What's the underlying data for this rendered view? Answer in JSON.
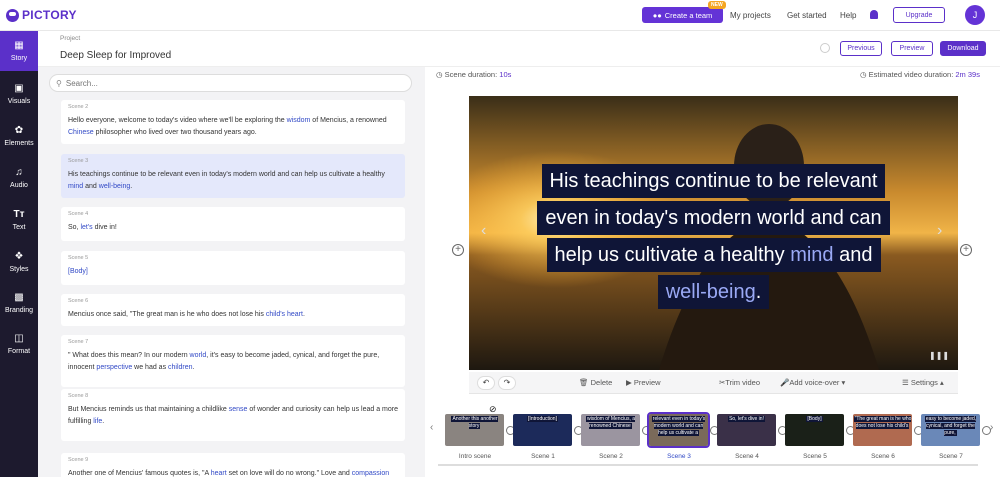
{
  "brand": {
    "name": "PICTORY"
  },
  "topnav": {
    "create_team": "Create a team",
    "new_badge": "NEW",
    "my_projects": "My projects",
    "get_started": "Get started",
    "help": "Help",
    "upgrade": "Upgrade",
    "avatar": "J"
  },
  "sidebar": {
    "items": [
      {
        "label": "Story",
        "icon": "story-icon"
      },
      {
        "label": "Visuals",
        "icon": "visuals-icon"
      },
      {
        "label": "Elements",
        "icon": "elements-icon"
      },
      {
        "label": "Audio",
        "icon": "audio-icon"
      },
      {
        "label": "Text",
        "icon": "text-icon"
      },
      {
        "label": "Styles",
        "icon": "styles-icon"
      },
      {
        "label": "Branding",
        "icon": "branding-icon"
      },
      {
        "label": "Format",
        "icon": "format-icon"
      }
    ]
  },
  "project": {
    "label": "Project",
    "title": "Deep Sleep for Improved"
  },
  "header_buttons": {
    "previous": "Previous",
    "preview": "Preview",
    "download": "Download"
  },
  "search": {
    "placeholder": "Search..."
  },
  "scenes": [
    {
      "label": "Scene 2",
      "html": "Hello everyone, welcome to today's video where we'll be exploring the <b>wisdom</b> of Mencius, a renowned <b>Chinese</b> philosopher who lived over two thousand years ago."
    },
    {
      "label": "Scene 3",
      "html": "His teachings continue to be relevant even in today's modern world and can help us cultivate a healthy <b>mind</b> and <b>well-being</b>."
    },
    {
      "label": "Scene 4",
      "html": "So, <b>let's</b> dive in!"
    },
    {
      "label": "Scene 5",
      "html": "<b>[Body]</b>"
    },
    {
      "label": "Scene 6",
      "html": "Mencius once said, \"The great man is he who does not lose his <b>child's heart</b>."
    },
    {
      "label": "Scene 7",
      "html": "\" What does this mean? In our modern <b>world</b>, it's easy to become jaded, cynical, and forget the pure, innocent <b>perspective</b> we had as <b>children</b>."
    },
    {
      "label": "Scene 8",
      "html": "But Mencius reminds us that maintaining a childlike <b>sense</b> of wonder and curiosity can help us lead a more fulfilling <b>life</b>."
    },
    {
      "label": "Scene 9",
      "html": "Another one of Mencius' famous quotes is, \"A <b>heart</b> set on love will do no wrong.\" Love and <b>compassion</b>"
    }
  ],
  "preview": {
    "scene_duration_label": "Scene duration:",
    "scene_duration": "10s",
    "estimated_label": "Estimated video duration:",
    "estimated": "2m 39s",
    "caption_lines": [
      "His teachings continue to be relevant",
      "even in today's modern world and can",
      "help us cultivate a healthy <b>mind</b> and",
      "<b>well-being</b>."
    ]
  },
  "controls": {
    "delete": "Delete",
    "preview": "Preview",
    "trim": "Trim video",
    "voiceover": "Add voice-over",
    "settings": "Settings"
  },
  "timeline": [
    {
      "label": "Intro scene",
      "caption": "Another this another story",
      "bg": "#8a8480"
    },
    {
      "label": "Scene 1",
      "caption": "[Introduction]",
      "bg": "#1c2a5a"
    },
    {
      "label": "Scene 2",
      "caption": "wisdom of Mencius, a renowned Chinese",
      "bg": "#9b95a0"
    },
    {
      "label": "Scene 3",
      "caption": "relevant even in today's modern world and can help us cultivate a",
      "bg": "#7a6a5a"
    },
    {
      "label": "Scene 4",
      "caption": "So, let's dive in!",
      "bg": "#3a3048"
    },
    {
      "label": "Scene 5",
      "caption": "[Body]",
      "bg": "#1a2018"
    },
    {
      "label": "Scene 6",
      "caption": "\"The great man is he who does not lose his child's",
      "bg": "#b06a50"
    },
    {
      "label": "Scene 7",
      "caption": "easy to become jaded, cynical, and forget the pure,",
      "bg": "#6a88b8"
    }
  ],
  "colors": {
    "accent": "#5b30c9",
    "sidebar_bg": "#1d1a2e",
    "caption_bg": "#0f1537",
    "highlight": "#9aa9f5"
  }
}
